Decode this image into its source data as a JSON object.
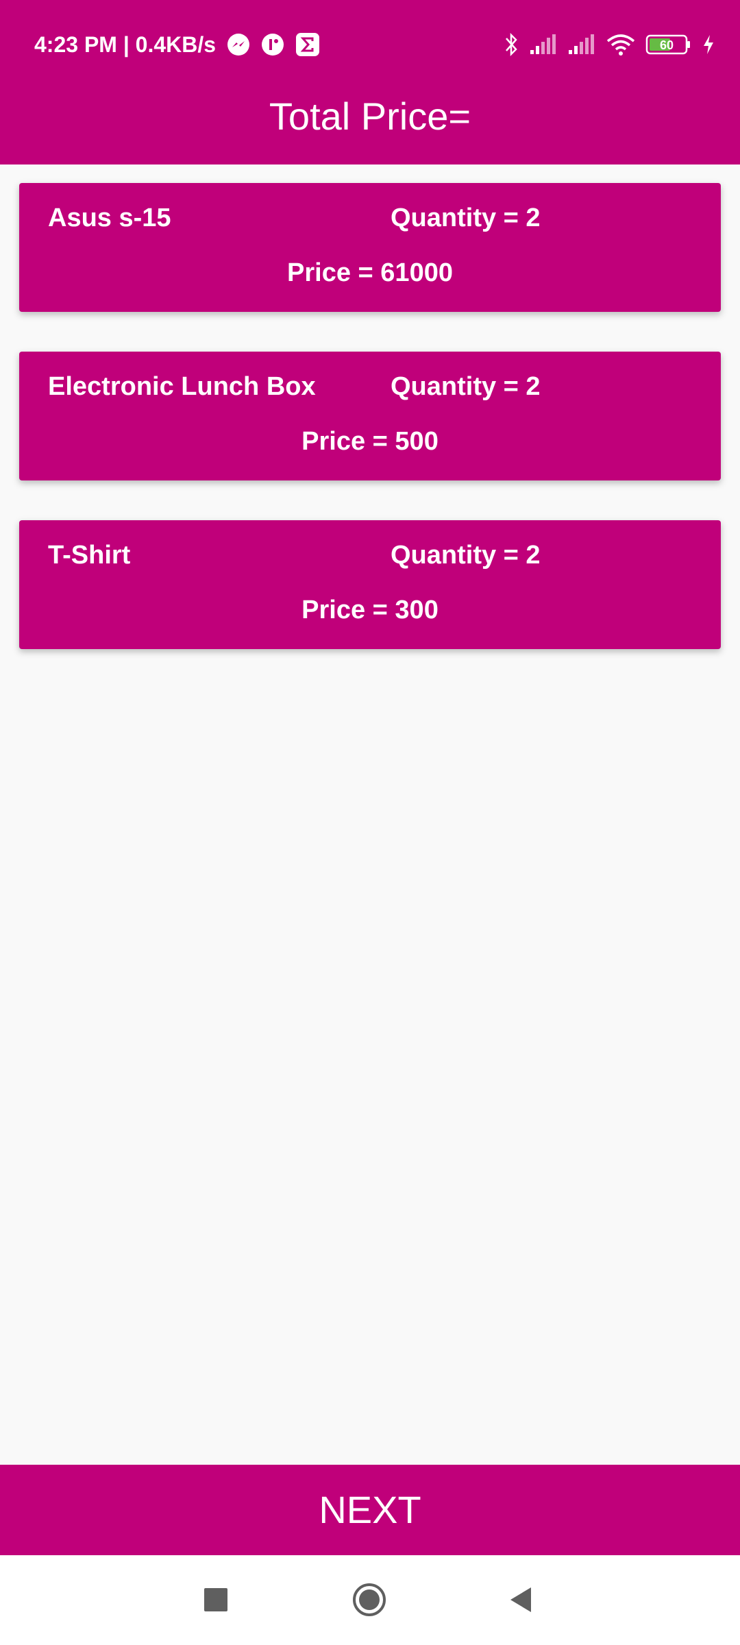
{
  "status_bar": {
    "time_speed": "4:23 PM | 0.4KB/s",
    "battery_level": "60",
    "icons": [
      "messenger-icon",
      "app-icon",
      "sigma-app-icon",
      "bluetooth-icon",
      "signal-icon",
      "signal-icon",
      "wifi-icon",
      "battery-icon",
      "charging-icon"
    ]
  },
  "header": {
    "title": "Total Price="
  },
  "cart": {
    "items": [
      {
        "name": "Asus s-15",
        "quantity": "Quantity = 2",
        "price": "Price = 61000"
      },
      {
        "name": "Electronic Lunch Box",
        "quantity": "Quantity = 2",
        "price": "Price = 500"
      },
      {
        "name": "T-Shirt",
        "quantity": "Quantity = 2",
        "price": "Price = 300"
      }
    ]
  },
  "actions": {
    "next_label": "NEXT"
  },
  "nav": {
    "icons": [
      "recents-icon",
      "home-icon",
      "back-icon"
    ]
  },
  "colors": {
    "primary": "#c0007a",
    "background": "#f9f9f9",
    "text_on_primary": "#ffffff"
  }
}
